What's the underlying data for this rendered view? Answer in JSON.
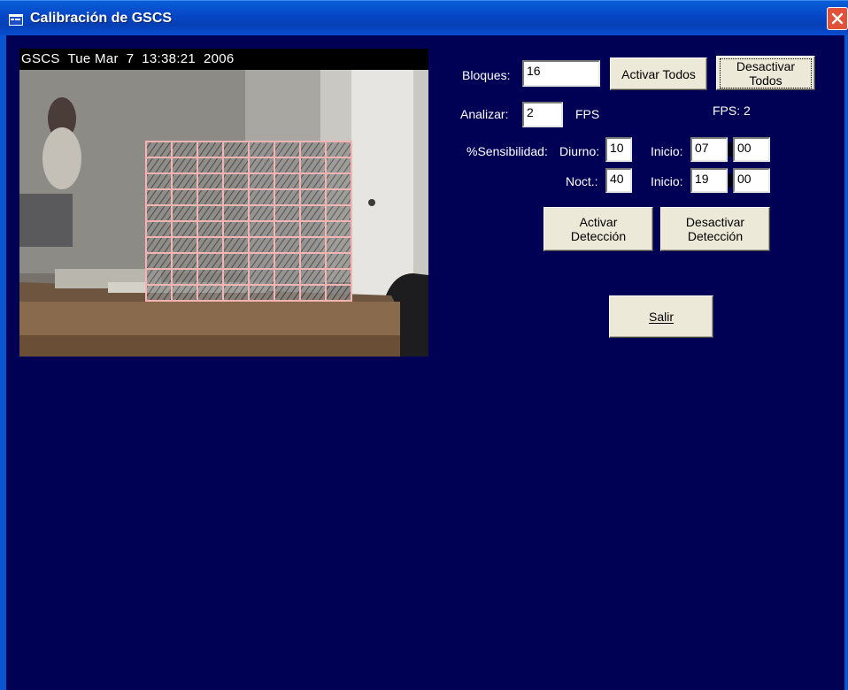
{
  "window": {
    "title": "Calibración de GSCS"
  },
  "video": {
    "overlay_text": "GSCS  Tue Mar  7  13:38:21  2006",
    "grid": {
      "rows": 10,
      "cols": 8,
      "color": "#f4b4b4"
    }
  },
  "controls": {
    "bloques_label": "Bloques:",
    "bloques_value": "16",
    "activar_todos": "Activar Todos",
    "desactivar_todos_line1": "Desactivar",
    "desactivar_todos_line2": "Todos",
    "analizar_label": "Analizar:",
    "analizar_value": "2",
    "fps_unit": "FPS",
    "fps_status": "FPS: 2",
    "sensibilidad_label": "%Sensibilidad:",
    "diurno_label": "Diurno:",
    "diurno_value": "10",
    "inicio_label_1": "Inicio:",
    "diurno_hour": "07",
    "diurno_min": "00",
    "noct_label": "Noct.:",
    "noct_value": "40",
    "inicio_label_2": "Inicio:",
    "noct_hour": "19",
    "noct_min": "00",
    "activar_deteccion_line1": "Activar",
    "activar_deteccion_line2": "Detección",
    "desactivar_deteccion_line1": "Desactivar",
    "desactivar_deteccion_line2": "Detección",
    "salir_label": "Salir"
  },
  "colors": {
    "background": "#000055",
    "titlebar": "#0648c8",
    "button_face": "#ece9d8"
  }
}
